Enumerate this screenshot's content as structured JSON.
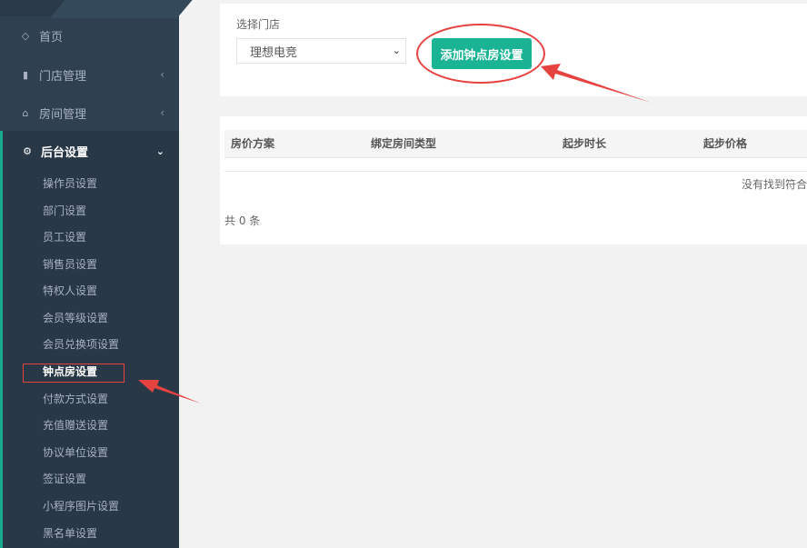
{
  "sidebar": {
    "items": [
      {
        "label": "首页",
        "icon": "diamond-icon"
      },
      {
        "label": "门店管理",
        "icon": "building-icon"
      },
      {
        "label": "房间管理",
        "icon": "home-icon"
      }
    ],
    "active_section": {
      "label": "后台设置",
      "icon": "gears-icon"
    },
    "sub_items": [
      "操作员设置",
      "部门设置",
      "员工设置",
      "销售员设置",
      "特权人设置",
      "会员等级设置",
      "会员兑换项设置",
      "钟点房设置",
      "付款方式设置",
      "充值赠送设置",
      "协议单位设置",
      "签证设置",
      "小程序图片设置",
      "黑名单设置"
    ],
    "current_sub_item": "钟点房设置",
    "accent_color": "#19aa8d"
  },
  "filter": {
    "store_label": "选择门店",
    "store_value": "理想电竞",
    "add_button_label": "添加钟点房设置"
  },
  "table": {
    "columns": [
      "房价方案",
      "绑定房间类型",
      "起步时长",
      "起步价格"
    ],
    "empty_text": "没有找到符合",
    "total_text": "共 0 条"
  },
  "colors": {
    "button": "#1ab394",
    "annotation": "#e64340",
    "sidebar_bg": "#2f4050"
  }
}
